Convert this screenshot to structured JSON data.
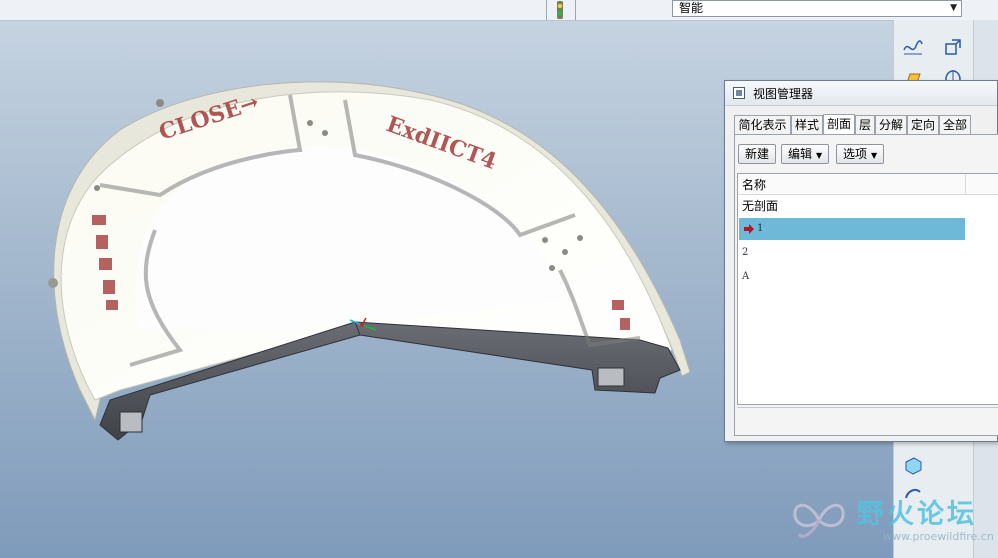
{
  "toolbar": {
    "filter_value": "智能"
  },
  "view_manager": {
    "title": "视图管理器",
    "tabs": [
      "简化表示",
      "样式",
      "剖面",
      "层",
      "分解",
      "定向",
      "全部"
    ],
    "active_tab": "剖面",
    "buttons": {
      "new": "新建",
      "edit": "编辑",
      "options": "选项"
    },
    "list_header": "名称",
    "items": [
      "无剖面",
      "1",
      "2",
      "A"
    ],
    "selected_item": "1"
  },
  "model_labels": {
    "close": "CLOSE→",
    "exhibit": "ExdIICT4"
  },
  "watermark": {
    "title": "野火论坛",
    "url": "www.proewildfire.cn"
  },
  "colors": {
    "selection": "#6fb9d8",
    "accent_arrow": "#b4122a",
    "watermark": "#55c1df"
  }
}
